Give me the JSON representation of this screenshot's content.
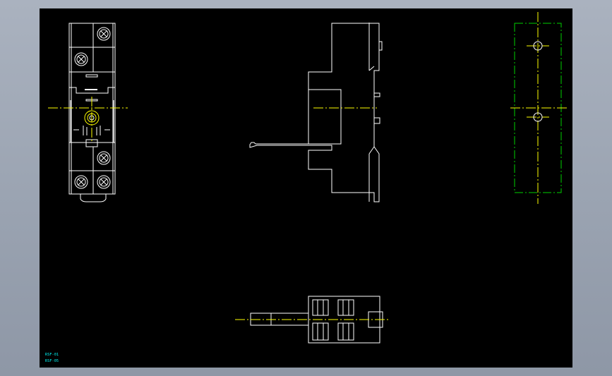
{
  "drawing": {
    "background": "#000000",
    "frame_colors": {
      "outline": "#ffffff",
      "centerline": "#ffff00",
      "hidden": "#00d000",
      "text": "#00ffff"
    }
  },
  "labels": {
    "line1": "RSF-01",
    "line2": "RSF-05"
  }
}
